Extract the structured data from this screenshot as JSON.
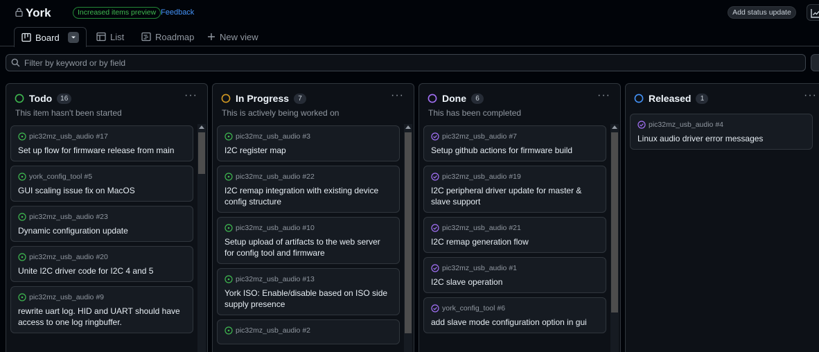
{
  "project": {
    "title": "York",
    "preview_badge": "Increased items preview",
    "feedback": "Feedback",
    "status_update": "Add status update"
  },
  "tabs": [
    {
      "label": "Board",
      "icon": "board-icon",
      "active": true
    },
    {
      "label": "List",
      "icon": "table-icon",
      "active": false
    },
    {
      "label": "Roadmap",
      "icon": "roadmap-icon",
      "active": false
    },
    {
      "label": "New view",
      "icon": "plus-icon",
      "active": false
    }
  ],
  "filter": {
    "placeholder": "Filter by keyword or by field"
  },
  "colors": {
    "todo": "#3fb950",
    "in_progress": "#d29922",
    "done": "#a371f7",
    "released": "#4493f8",
    "open_issue": "#3fb950",
    "closed_issue": "#a371f7"
  },
  "columns": [
    {
      "title": "Todo",
      "count": "16",
      "description": "This item hasn't been started",
      "cards": [
        {
          "ref": "pic32mz_usb_audio #17",
          "title": "Set up flow for firmware release from main",
          "state": "open"
        },
        {
          "ref": "york_config_tool #5",
          "title": "GUI scaling issue fix on MacOS",
          "state": "open"
        },
        {
          "ref": "pic32mz_usb_audio #23",
          "title": "Dynamic configuration update",
          "state": "open"
        },
        {
          "ref": "pic32mz_usb_audio #20",
          "title": "Unite I2C driver code for I2C 4 and 5",
          "state": "open"
        },
        {
          "ref": "pic32mz_usb_audio #9",
          "title": "rewrite uart log. HID and UART should have access to one log ringbuffer.",
          "state": "open"
        }
      ]
    },
    {
      "title": "In Progress",
      "count": "7",
      "description": "This is actively being worked on",
      "cards": [
        {
          "ref": "pic32mz_usb_audio #3",
          "title": "I2C register map",
          "state": "open"
        },
        {
          "ref": "pic32mz_usb_audio #22",
          "title": "I2C remap integration with existing device config structure",
          "state": "open"
        },
        {
          "ref": "pic32mz_usb_audio #10",
          "title": "Setup upload of artifacts to the web server for config tool and firmware",
          "state": "open"
        },
        {
          "ref": "pic32mz_usb_audio #13",
          "title": "York ISO: Enable/disable based on ISO side supply presence",
          "state": "open"
        },
        {
          "ref": "pic32mz_usb_audio #2",
          "title": "",
          "state": "open"
        }
      ]
    },
    {
      "title": "Done",
      "count": "6",
      "description": "This has been completed",
      "cards": [
        {
          "ref": "pic32mz_usb_audio #7",
          "title": "Setup github actions for firmware build",
          "state": "closed"
        },
        {
          "ref": "pic32mz_usb_audio #19",
          "title": "I2C peripheral driver update for master & slave support",
          "state": "closed"
        },
        {
          "ref": "pic32mz_usb_audio #21",
          "title": "I2C remap generation flow",
          "state": "closed"
        },
        {
          "ref": "pic32mz_usb_audio #1",
          "title": "I2C slave operation",
          "state": "closed"
        },
        {
          "ref": "york_config_tool #6",
          "title": "add slave mode configuration option in gui",
          "state": "closed"
        }
      ]
    },
    {
      "title": "Released",
      "count": "1",
      "description": "",
      "cards": [
        {
          "ref": "pic32mz_usb_audio #4",
          "title": "Linux audio driver error messages",
          "state": "closed"
        }
      ]
    }
  ]
}
